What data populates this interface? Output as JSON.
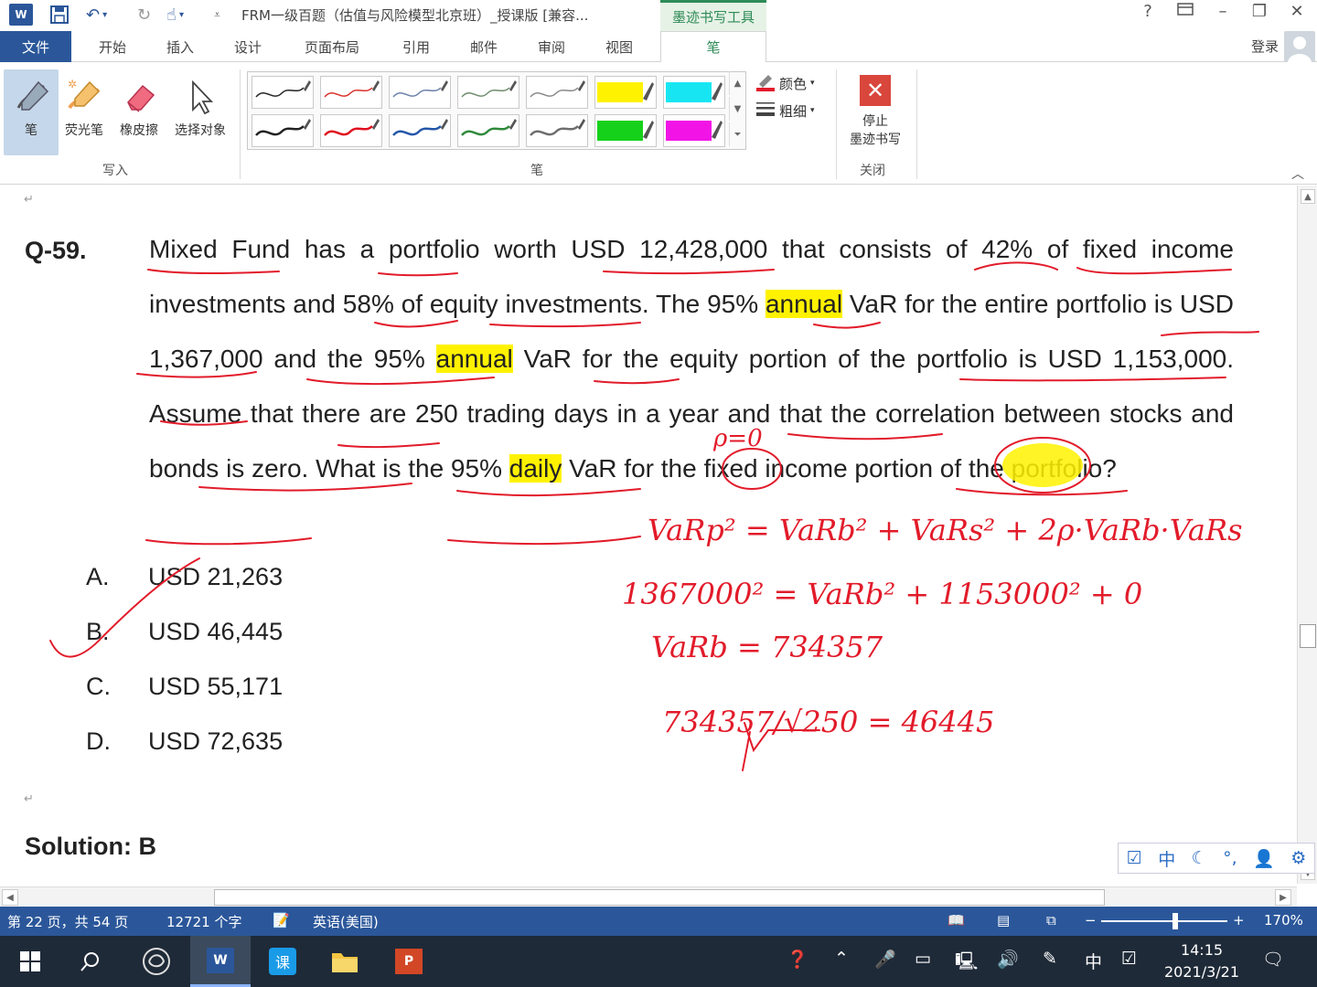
{
  "window": {
    "title": "FRM一级百题（估值与风险模型北京班）_授课版 [兼容...",
    "context_tab_header": "墨迹书写工具",
    "help": "?",
    "login": "登录"
  },
  "ribbon_tabs": [
    "文件",
    "开始",
    "插入",
    "设计",
    "页面布局",
    "引用",
    "邮件",
    "审阅",
    "视图",
    "笔"
  ],
  "ribbon": {
    "write_tools": [
      {
        "label": "笔",
        "icon": "pen-icon"
      },
      {
        "label": "荧光笔",
        "icon": "highlighter-icon"
      },
      {
        "label": "橡皮擦",
        "icon": "eraser-icon"
      },
      {
        "label": "选择对象",
        "icon": "select-arrow-icon"
      }
    ],
    "write_group_label": "写入",
    "pens_group_label": "笔",
    "color_label": "颜色",
    "thickness_label": "粗细",
    "stop_label_1": "停止",
    "stop_label_2": "墨迹书写",
    "close_group_label": "关闭",
    "pen_colors": [
      "#222222",
      "#d9302b",
      "#6a7fa8",
      "#6d8c6d",
      "#888888",
      "#fff200",
      "#17e6f2",
      "#222222",
      "#e0101f",
      "#2456a8",
      "#2f8a3b",
      "#6e6e6e",
      "#16d11a",
      "#f214e6"
    ]
  },
  "document": {
    "question_number": "Q-59.",
    "question_parts": [
      "Mixed Fund has a portfolio worth USD 12,428,000 that consists of 42% of fixed income investments and 58% of equity investments. The 95% ",
      "annual",
      " VaR for the entire portfolio is USD 1,367,000 and the 95% ",
      "annual",
      " VaR for the equity portion of the portfolio is USD 1,153,000. Assume that there are 250 trading days in a year and that the correlation between stocks and bonds is zero. What is the 95% ",
      "daily",
      " VaR for the fixed income portion of the portfolio?"
    ],
    "options": [
      {
        "letter": "A.",
        "text": "USD 21,263"
      },
      {
        "letter": "B.",
        "text": "USD 46,445"
      },
      {
        "letter": "C.",
        "text": "USD 55,171"
      },
      {
        "letter": "D.",
        "text": "USD 72,635"
      }
    ],
    "solution": "Solution: B",
    "ink_annotations": [
      "ρ=0",
      "VaRp² = VaRb² + VaRs² + 2ρ·VaRb·VaRs",
      "1367000² = VaRb² + 1153000² + 0",
      "VaRb = 734357",
      "734357/√250 = 46445"
    ]
  },
  "statusbar": {
    "page": "第 22 页，共 54 页",
    "words": "12721 个字",
    "language": "英语(美国)",
    "zoom": "170%"
  },
  "ime": {
    "mode": "中"
  },
  "taskbar": {
    "ime": "中",
    "time": "14:15",
    "date": "2021/3/21"
  }
}
